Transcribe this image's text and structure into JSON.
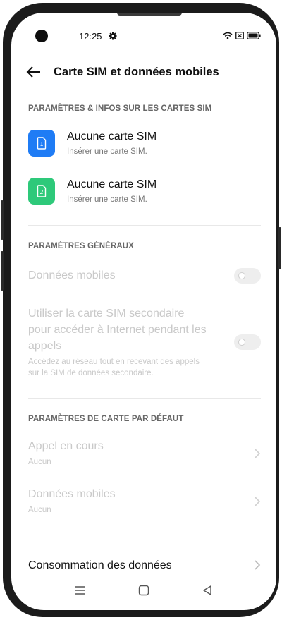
{
  "status_bar": {
    "time": "12:25"
  },
  "header": {
    "title": "Carte SIM et données mobiles"
  },
  "sections": {
    "sim_cards_label": "PARAMÈTRES & INFOS SUR LES CARTES SIM",
    "general_label": "PARAMÈTRES GÉNÉRAUX",
    "default_label": "PARAMÈTRES DE CARTE PAR DÉFAUT"
  },
  "sim_cards": [
    {
      "icon_number": "1",
      "title": "Aucune carte SIM",
      "subtitle": "Insérer une carte SIM.",
      "color": "#1f7cf5"
    },
    {
      "icon_number": "2",
      "title": "Aucune carte SIM",
      "subtitle": "Insérer une carte SIM.",
      "color": "#2ec97a"
    }
  ],
  "general": {
    "mobile_data": {
      "label": "Données mobiles",
      "enabled": false
    },
    "secondary_sim": {
      "label_line1": "Utiliser la carte SIM secondaire",
      "label_line2": "pour accéder à Internet pendant les",
      "label_line3": "appels",
      "desc_line1": "Accédez au réseau tout en recevant des appels",
      "desc_line2": "sur la SIM de données secondaire.",
      "enabled": false
    }
  },
  "default_card": {
    "call": {
      "label": "Appel en cours",
      "value": "Aucun"
    },
    "mobile_data": {
      "label": "Données mobiles",
      "value": "Aucun"
    }
  },
  "data_usage": {
    "label": "Consommation des données"
  },
  "icons": {
    "back": "arrow-left-icon",
    "settings": "gear-icon",
    "wifi": "wifi-icon",
    "battery": "battery-icon",
    "chevron": "chevron-right-icon"
  }
}
